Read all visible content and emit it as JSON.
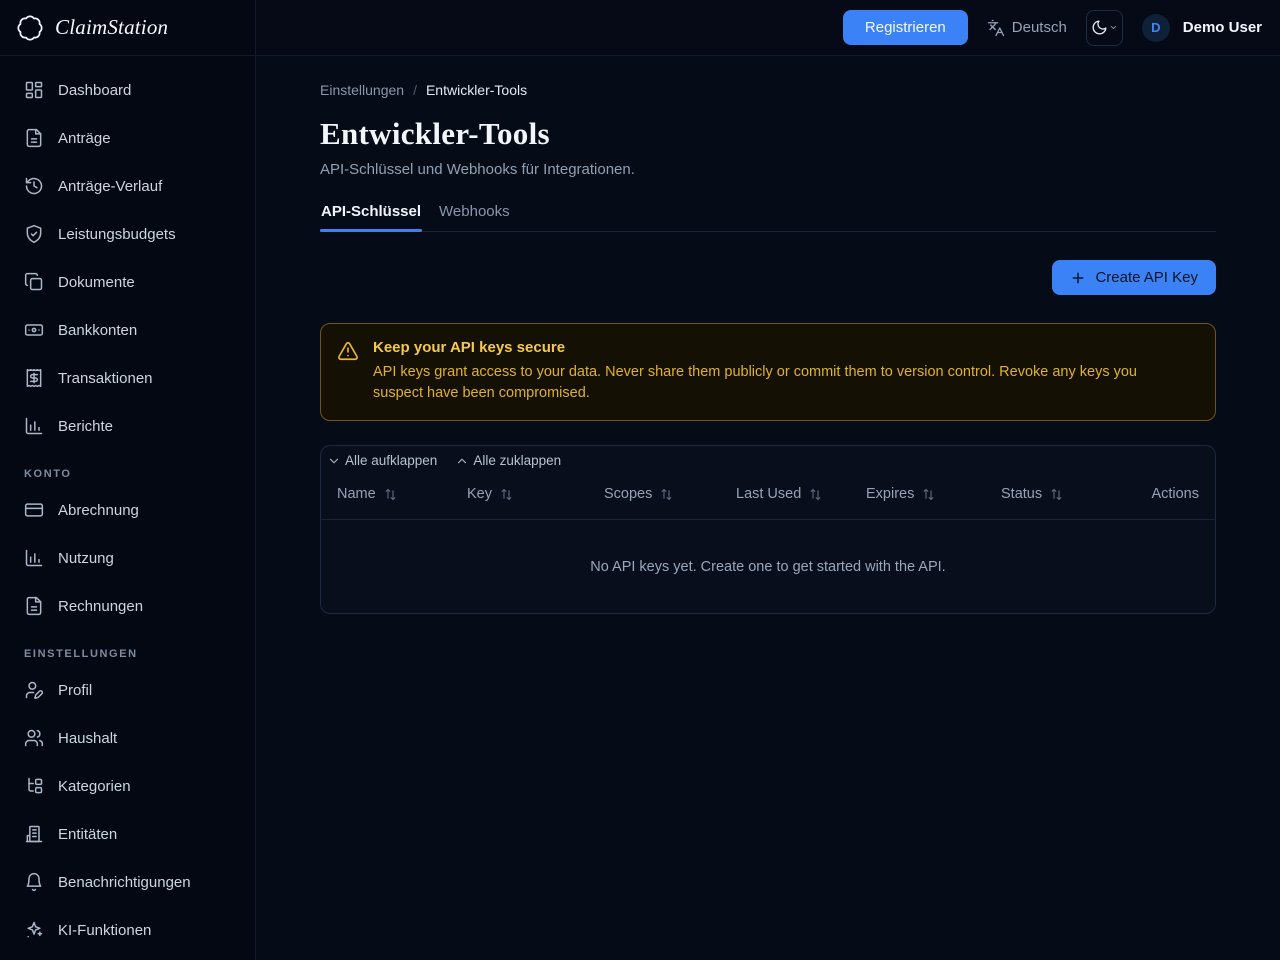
{
  "brand": {
    "name": "ClaimStation"
  },
  "topbar": {
    "register_label": "Registrieren",
    "language_label": "Deutsch",
    "user_initial": "D",
    "user_name": "Demo User"
  },
  "sidebar": {
    "sections": [
      {
        "heading": "",
        "items": [
          {
            "label": "Dashboard",
            "icon": "dashboard-icon"
          },
          {
            "label": "Anträge",
            "icon": "file-text-icon"
          },
          {
            "label": "Anträge-Verlauf",
            "icon": "history-icon"
          },
          {
            "label": "Leistungsbudgets",
            "icon": "shield-check-icon"
          },
          {
            "label": "Dokumente",
            "icon": "copy-icon"
          },
          {
            "label": "Bankkonten",
            "icon": "banknote-icon"
          },
          {
            "label": "Transaktionen",
            "icon": "receipt-icon"
          },
          {
            "label": "Berichte",
            "icon": "chart-column-icon"
          }
        ]
      },
      {
        "heading": "Konto",
        "items": [
          {
            "label": "Abrechnung",
            "icon": "credit-card-icon"
          },
          {
            "label": "Nutzung",
            "icon": "chart-column-icon"
          },
          {
            "label": "Rechnungen",
            "icon": "file-text-icon"
          }
        ]
      },
      {
        "heading": "Einstellungen",
        "items": [
          {
            "label": "Profil",
            "icon": "user-pen-icon"
          },
          {
            "label": "Haushalt",
            "icon": "users-icon"
          },
          {
            "label": "Kategorien",
            "icon": "folder-tree-icon"
          },
          {
            "label": "Entitäten",
            "icon": "building-icon"
          },
          {
            "label": "Benachrichtigungen",
            "icon": "bell-icon"
          },
          {
            "label": "KI-Funktionen",
            "icon": "sparkles-icon"
          }
        ]
      }
    ]
  },
  "page": {
    "breadcrumb": {
      "parent": "Einstellungen",
      "separator": "/",
      "current": "Entwickler-Tools"
    },
    "title": "Entwickler-Tools",
    "subtitle": "API-Schlüssel und Webhooks für Integrationen.",
    "tabs": [
      {
        "label": "API-Schlüssel",
        "active": true
      },
      {
        "label": "Webhooks",
        "active": false
      }
    ],
    "create_button_label": "Create API Key",
    "warning": {
      "title": "Keep your API keys secure",
      "body": "API keys grant access to your data. Never share them publicly or commit them to version control. Revoke any keys you suspect have been compromised."
    },
    "table": {
      "expand_all_label": "Alle aufklappen",
      "collapse_all_label": "Alle zuklappen",
      "columns": [
        "Name",
        "Key",
        "Scopes",
        "Last Used",
        "Expires",
        "Status",
        "Actions"
      ],
      "empty_message": "No API keys yet. Create one to get started with the API."
    }
  },
  "colors": {
    "accent_blue": "#3b82f6",
    "warning_border": "#6e5417",
    "warning_text": "#ddb22e",
    "warning_title": "#f4c94f",
    "background": "#060b18"
  }
}
